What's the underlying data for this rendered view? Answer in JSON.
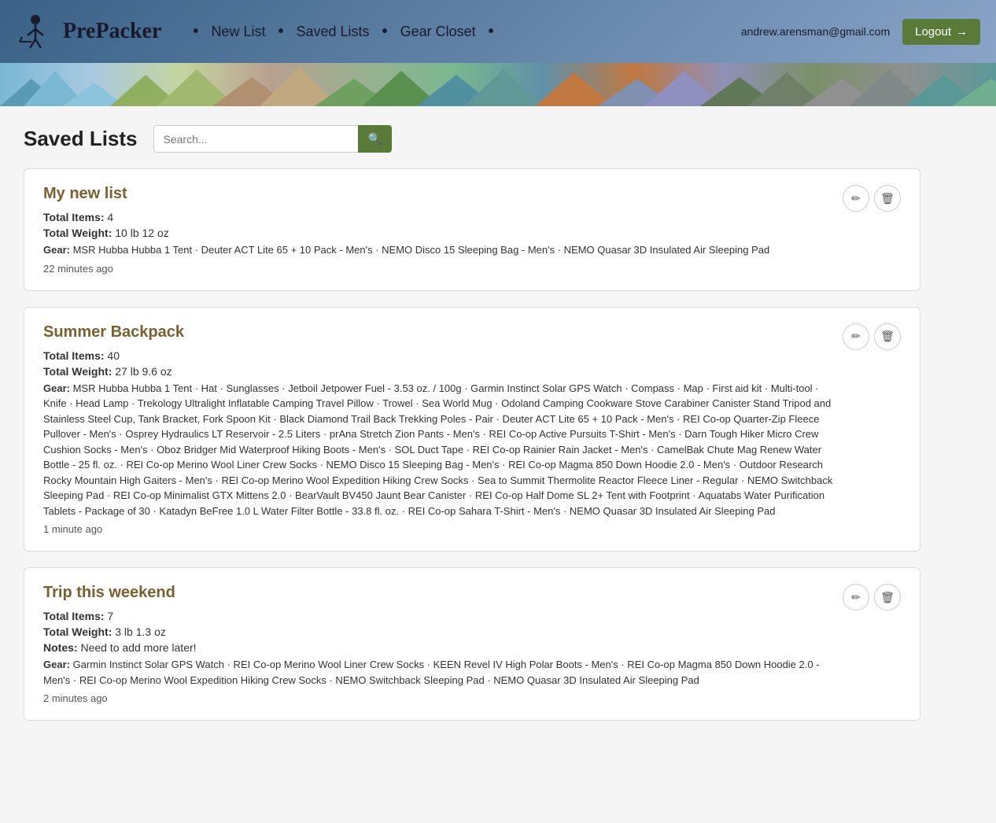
{
  "navbar": {
    "logo_text": "PrePacker",
    "links": [
      {
        "label": "New List",
        "name": "new-list"
      },
      {
        "label": "Saved Lists",
        "name": "saved-lists"
      },
      {
        "label": "Gear Closet",
        "name": "gear-closet"
      }
    ],
    "user_email": "andrew.arensman@gmail.com",
    "logout_label": "Logout"
  },
  "page": {
    "title": "Saved Lists",
    "search_placeholder": "Search..."
  },
  "lists": [
    {
      "name": "My new list",
      "total_items": "4",
      "total_weight": "10 lb 12 oz",
      "notes": null,
      "gear": "MSR Hubba Hubba 1 Tent · Deuter ACT Lite 65 + 10 Pack - Men's · NEMO Disco 15 Sleeping Bag - Men's · NEMO Quasar 3D Insulated Air Sleeping Pad",
      "timestamp": "22 minutes ago"
    },
    {
      "name": "Summer Backpack",
      "total_items": "40",
      "total_weight": "27 lb 9.6 oz",
      "notes": null,
      "gear": "MSR Hubba Hubba 1 Tent · Hat · Sunglasses · Jetboil Jetpower Fuel - 3.53 oz. / 100g · Garmin Instinct Solar GPS Watch · Compass · Map · First aid kit · Multi-tool · Knife · Head Lamp · Trekology Ultralight Inflatable Camping Travel Pillow · Trowel · Sea World Mug · Odoland Camping Cookware Stove Carabiner Canister Stand Tripod and Stainless Steel Cup, Tank Bracket, Fork Spoon Kit · Black Diamond Trail Back Trekking Poles - Pair · Deuter ACT Lite 65 + 10 Pack - Men's · REI Co-op Quarter-Zip Fleece Pullover - Men's · Osprey Hydraulics LT Reservoir - 2.5 Liters · prAna Stretch Zion Pants - Men's · REI Co-op Active Pursuits T-Shirt - Men's · Darn Tough Hiker Micro Crew Cushion Socks - Men's · Oboz Bridger Mid Waterproof Hiking Boots - Men's · SOL Duct Tape · REI Co-op Rainier Rain Jacket - Men's · CamelBak Chute Mag Renew Water Bottle - 25 fl. oz. · REI Co-op Merino Wool Liner Crew Socks · NEMO Disco 15 Sleeping Bag - Men's · REI Co-op Magma 850 Down Hoodie 2.0 - Men's · Outdoor Research Rocky Mountain High Gaiters - Men's · REI Co-op Merino Wool Expedition Hiking Crew Socks · Sea to Summit Thermolite Reactor Fleece Liner - Regular · NEMO Switchback Sleeping Pad · REI Co-op Minimalist GTX Mittens 2.0 · BearVault BV450 Jaunt Bear Canister · REI Co-op Half Dome SL 2+ Tent with Footprint · Aquatabs Water Purification Tablets - Package of 30 · Katadyn BeFree 1.0 L Water Filter Bottle - 33.8 fl. oz. · REI Co-op Sahara T-Shirt - Men's · NEMO Quasar 3D Insulated Air Sleeping Pad",
      "timestamp": "1 minute ago"
    },
    {
      "name": "Trip this weekend",
      "total_items": "7",
      "total_weight": "3 lb 1.3 oz",
      "notes": "Need to add more later!",
      "gear": "Garmin Instinct Solar GPS Watch · REI Co-op Merino Wool Liner Crew Socks · KEEN Revel IV High Polar Boots - Men's · REI Co-op Magma 850 Down Hoodie 2.0 - Men's · REI Co-op Merino Wool Expedition Hiking Crew Socks · NEMO Switchback Sleeping Pad · NEMO Quasar 3D Insulated Air Sleeping Pad",
      "timestamp": "2 minutes ago"
    }
  ],
  "icons": {
    "search": "🔍",
    "edit": "✏",
    "delete": "🗑",
    "logout_arrow": "→"
  }
}
